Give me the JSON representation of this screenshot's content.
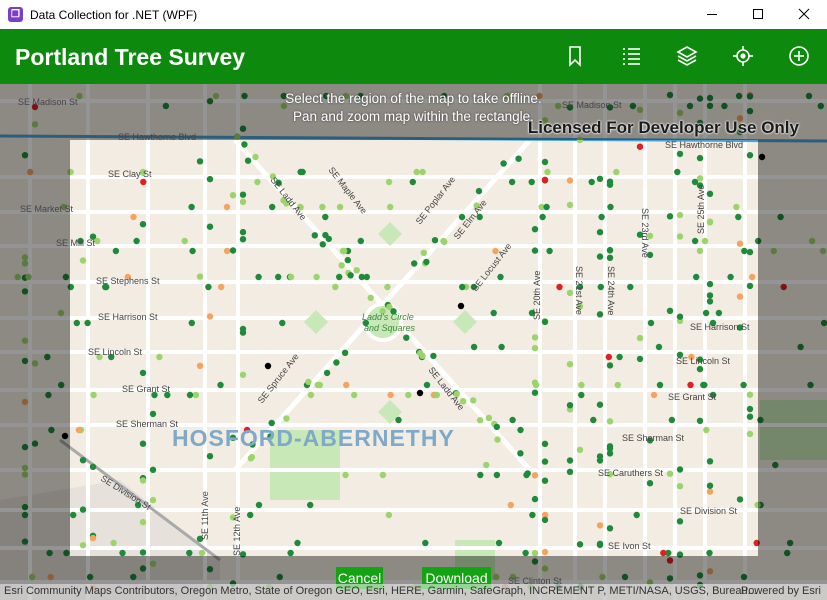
{
  "window": {
    "title": "Data Collection for .NET (WPF)"
  },
  "appbar": {
    "title": "Portland Tree Survey",
    "tools": [
      "bookmark-icon",
      "legend-list-icon",
      "layers-icon",
      "locate-icon",
      "add-icon"
    ]
  },
  "map": {
    "instructions": [
      "Select the region of the map to take offline.",
      "Pan and zoom map within the rectangle."
    ],
    "license": "Licensed For Developer Use Only",
    "district": "HOSFORD-ABERNETHY",
    "park_label": [
      "Ladd's Circle",
      "and Squares"
    ],
    "streets": {
      "madison_w": "SE Madison St",
      "madison_e": "SE Madison St",
      "hawthorne_w": "SE Hawthorne Blvd",
      "hawthorne_e": "SE Hawthorne Blvd",
      "clay": "SE Clay St",
      "market": "SE Market St",
      "mill": "SE Mill St",
      "stephens": "SE Stephens St",
      "harrison_w": "SE Harrison St",
      "harrison_e": "SE Harrison St",
      "lincoln_w": "SE Lincoln St",
      "lincoln_e": "SE Lincoln St",
      "grant_w": "SE Grant St",
      "grant_e": "SE Grant St",
      "sherman_w": "SE Sherman St",
      "sherman_e": "SE Sherman St",
      "caruthers": "SE Caruthers St",
      "division_w": "SE Division St",
      "division_e": "SE Division St",
      "ivon": "SE Ivon St",
      "clinton": "SE Clinton St",
      "ladd_nw": "SE Ladd Ave",
      "ladd_se": "SE Ladd Ave",
      "maple": "SE Maple Ave",
      "poplar": "SE Poplar Ave",
      "elm": "SE Elm Ave",
      "locust": "SE Locust Ave",
      "spruce": "SE Spruce Ave",
      "ave20": "SE 20th Ave",
      "ave21": "SE 21st Ave",
      "ave23": "SE 23rd Ave",
      "ave24": "SE 24th Ave",
      "ave25": "SE 25th Ave",
      "ave11": "SE 11th Ave",
      "ave12": "SE 12th Ave"
    }
  },
  "actions": {
    "cancel": "Cancel",
    "download": "Download"
  },
  "attribution": {
    "text": "Esri Community Maps Contributors, Oregon Metro, State of Oregon GEO, Esri, HERE, Garmin, SafeGraph, INCREMENT P, METI/NASA, USGS, Bureau...",
    "powered": "Powered by Esri"
  },
  "colors": {
    "appbar": "#0d8a0d",
    "button": "#13a313",
    "tree_healthy": "#1e8a3a",
    "tree_light": "#9bd46a",
    "tree_orange": "#f4a460",
    "tree_red": "#e02020",
    "tree_dead": "#000000"
  }
}
